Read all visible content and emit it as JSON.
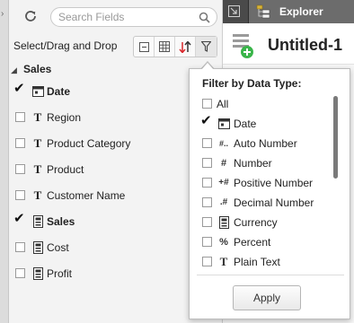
{
  "search": {
    "placeholder": "Search Fields"
  },
  "toolbar": {
    "select_label": "Select/Drag and Drop"
  },
  "tree": {
    "root_label": "Sales"
  },
  "fields": [
    {
      "label": "Date",
      "type": "date",
      "checked": true,
      "bold": true
    },
    {
      "label": "Region",
      "type": "text",
      "checked": false,
      "bold": false
    },
    {
      "label": "Product Category",
      "type": "text",
      "checked": false,
      "bold": false
    },
    {
      "label": "Product",
      "type": "text",
      "checked": false,
      "bold": false
    },
    {
      "label": "Customer Name",
      "type": "text",
      "checked": false,
      "bold": false
    },
    {
      "label": "Sales",
      "type": "number",
      "checked": true,
      "bold": true
    },
    {
      "label": "Cost",
      "type": "number",
      "checked": false,
      "bold": false
    },
    {
      "label": "Profit",
      "type": "number",
      "checked": false,
      "bold": false
    }
  ],
  "header": {
    "tab_label": "Explorer",
    "doc_title": "Untitled-1"
  },
  "filter": {
    "title": "Filter by Data Type:",
    "options": [
      {
        "label": "All",
        "checked": false,
        "icon": ""
      },
      {
        "label": "Date",
        "checked": true,
        "icon": "date-icon"
      },
      {
        "label": "Auto Number",
        "checked": false,
        "icon": "#.."
      },
      {
        "label": "Number",
        "checked": false,
        "icon": "#"
      },
      {
        "label": "Positive Number",
        "checked": false,
        "icon": "+#"
      },
      {
        "label": "Decimal Number",
        "checked": false,
        "icon": ".#"
      },
      {
        "label": "Currency",
        "checked": false,
        "icon": "currency-icon"
      },
      {
        "label": "Percent",
        "checked": false,
        "icon": "%"
      },
      {
        "label": "Plain Text",
        "checked": false,
        "icon": "T"
      }
    ],
    "apply_label": "Apply"
  },
  "colors": {
    "tab_strip": "#4a4a4a",
    "explorer_tab": "#6c6c6c",
    "new_badge": "#3ab54a",
    "red_arrow": "#d9262b"
  }
}
